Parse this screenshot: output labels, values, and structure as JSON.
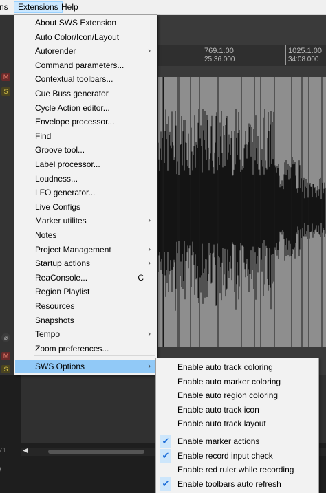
{
  "menubar": {
    "items": [
      {
        "label": "ns"
      },
      {
        "label": "Extensions"
      },
      {
        "label": "Help"
      }
    ]
  },
  "track": {
    "mute_label": "M",
    "solo_label": "S"
  },
  "ruler": {
    "marks": [
      {
        "measure": "769.1.00",
        "time": "25:36.000"
      },
      {
        "measure": "1025.1.00",
        "time": "34:08.000"
      }
    ]
  },
  "timeline": {
    "left_number": "71"
  },
  "extensions_menu": {
    "items": [
      {
        "label": "About SWS Extension",
        "submenu": false
      },
      {
        "label": "Auto Color/Icon/Layout",
        "submenu": false
      },
      {
        "label": "Autorender",
        "submenu": true
      },
      {
        "label": "Command parameters...",
        "submenu": false
      },
      {
        "label": "Contextual toolbars...",
        "submenu": false
      },
      {
        "label": "Cue Buss generator",
        "submenu": false
      },
      {
        "label": "Cycle Action editor...",
        "submenu": false
      },
      {
        "label": "Envelope processor...",
        "submenu": false
      },
      {
        "label": "Find",
        "submenu": false
      },
      {
        "label": "Groove tool...",
        "submenu": false
      },
      {
        "label": "Label processor...",
        "submenu": false
      },
      {
        "label": "Loudness...",
        "submenu": false
      },
      {
        "label": "LFO generator...",
        "submenu": false
      },
      {
        "label": "Live Configs",
        "submenu": false
      },
      {
        "label": "Marker utilites",
        "submenu": true
      },
      {
        "label": "Notes",
        "submenu": false
      },
      {
        "label": "Project Management",
        "submenu": true
      },
      {
        "label": "Startup actions",
        "submenu": true
      },
      {
        "label": "ReaConsole...",
        "submenu": false,
        "shortcut": "C"
      },
      {
        "label": "Region Playlist",
        "submenu": false
      },
      {
        "label": "Resources",
        "submenu": false
      },
      {
        "label": "Snapshots",
        "submenu": false
      },
      {
        "label": "Tempo",
        "submenu": true
      },
      {
        "label": "Zoom preferences...",
        "submenu": false
      }
    ],
    "highlighted": {
      "label": "SWS Options",
      "submenu": true
    },
    "arrow_glyph": "›"
  },
  "sws_options_submenu": {
    "group1": [
      {
        "label": "Enable auto track coloring",
        "checked": false
      },
      {
        "label": "Enable auto marker coloring",
        "checked": false
      },
      {
        "label": "Enable auto region coloring",
        "checked": false
      },
      {
        "label": "Enable auto track icon",
        "checked": false
      },
      {
        "label": "Enable auto track layout",
        "checked": false
      }
    ],
    "group2": [
      {
        "label": "Enable marker actions",
        "checked": true
      },
      {
        "label": "Enable record input check",
        "checked": true
      },
      {
        "label": "Enable red ruler while recording",
        "checked": false
      },
      {
        "label": "Enable toolbars auto refresh",
        "checked": true
      }
    ],
    "check_glyph": "✔"
  },
  "colors": {
    "menu_bg": "#f2f2f2",
    "highlight": "#91c9f7",
    "check": "#1e6fd9",
    "waveform": "#141414",
    "waveform_bg": "#8e8e8e",
    "mute": "#c0392b",
    "solo": "#c9b000"
  }
}
